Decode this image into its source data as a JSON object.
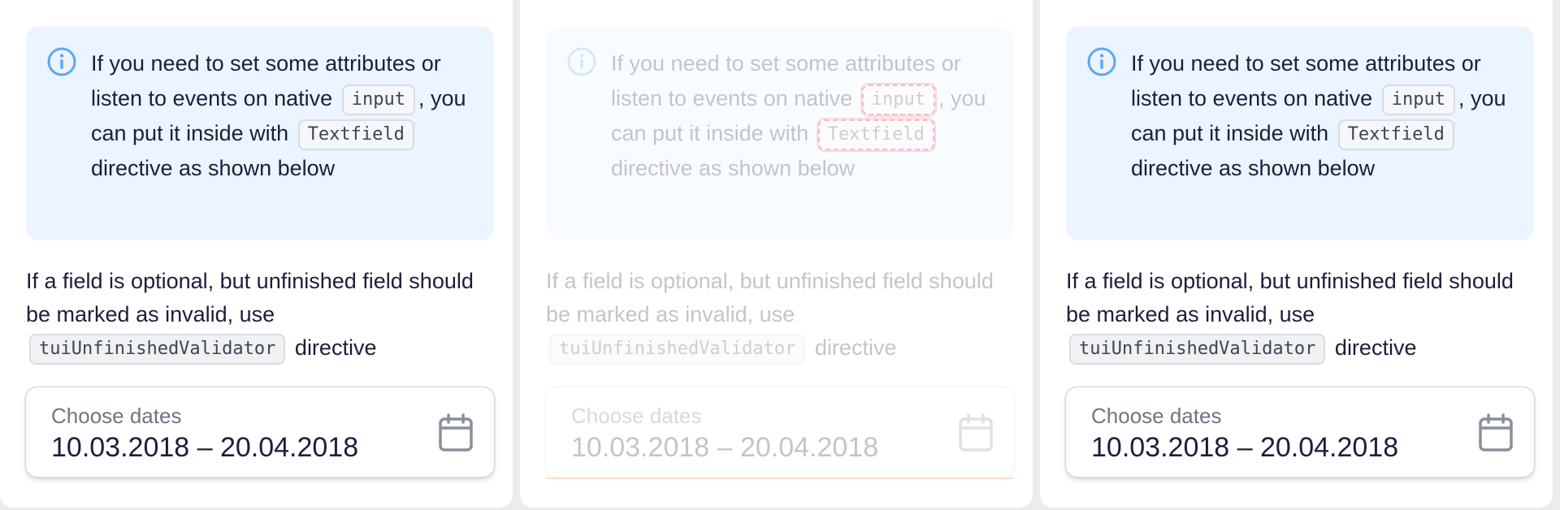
{
  "notification": {
    "text_before": "If you need to set some attributes or listen to events on native",
    "code_input": "input",
    "text_middle": ", you can put it inside with",
    "code_textfield": "Textfield",
    "text_after": "directive as shown below"
  },
  "paragraph": {
    "text_before": "If a field is optional, but unfinished field should be marked as invalid, use",
    "code_validator": "tuiUnfinishedValidator",
    "text_after": "directive"
  },
  "date_field": {
    "label": "Choose dates",
    "value": "10.03.2018 – 20.04.2018"
  },
  "icons": [
    "info-icon",
    "calendar-icon"
  ],
  "colors": {
    "notification_bg": "#ebf4ff",
    "info_icon": "#5aa9f0",
    "highlight_outline": "#e3001b"
  }
}
